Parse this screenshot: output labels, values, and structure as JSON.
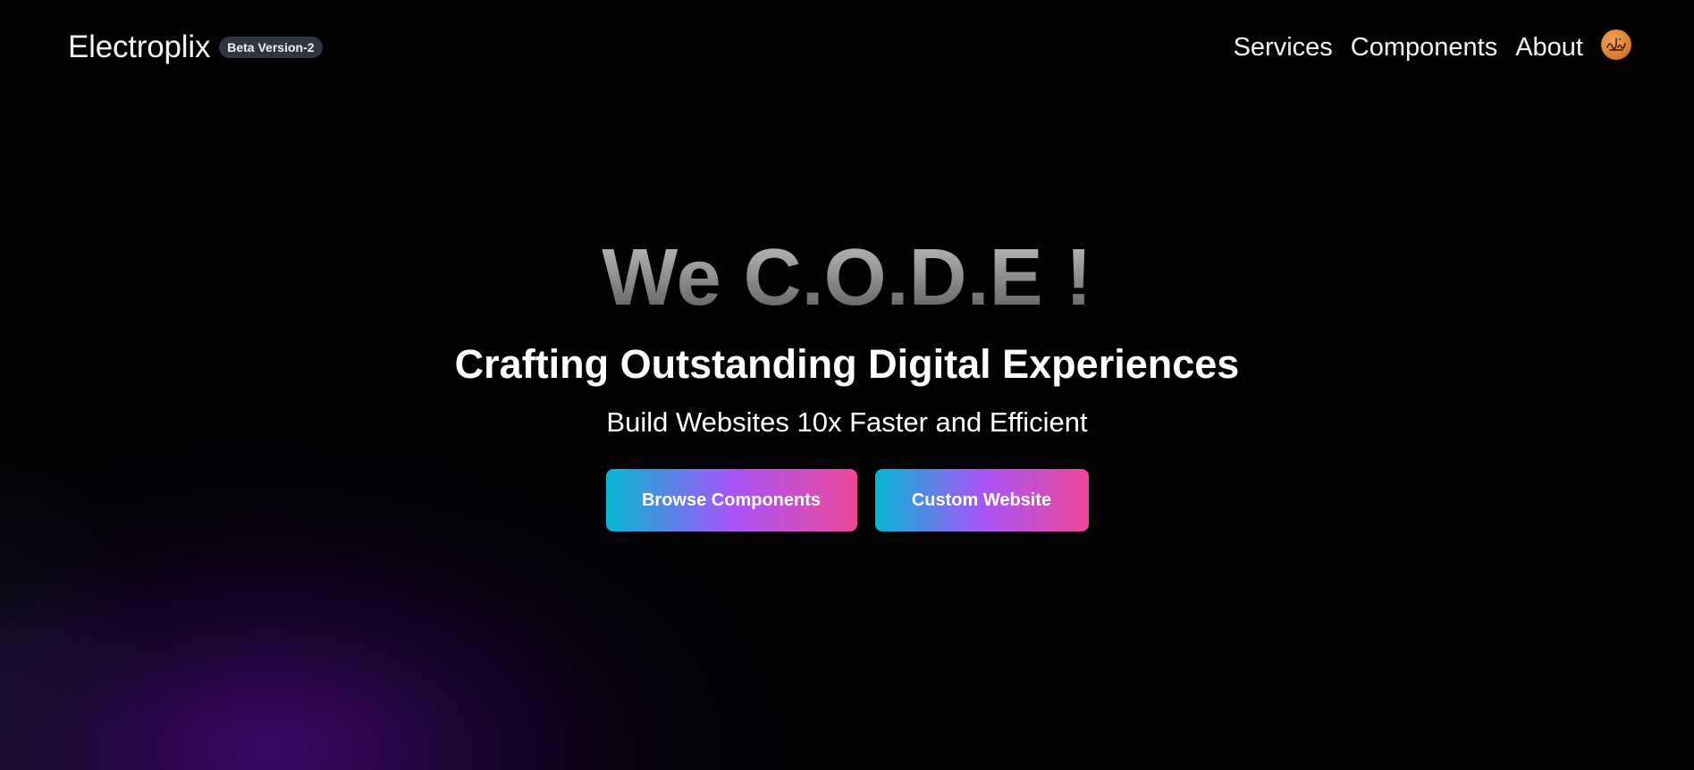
{
  "header": {
    "brand": "Electroplix",
    "badge": "Beta Version-2",
    "nav": [
      {
        "label": "Services"
      },
      {
        "label": "Components"
      },
      {
        "label": "About"
      }
    ],
    "avatar_icon": "avatar-logo-icon"
  },
  "hero": {
    "title": "We C.O.D.E !",
    "subtitle": "Crafting Outstanding Digital Experiences",
    "tagline": "Build Websites 10x Faster and Efficient",
    "buttons": {
      "browse": "Browse Components",
      "custom": "Custom Website"
    }
  },
  "colors": {
    "background": "#000000",
    "badge_bg": "#2f3542",
    "gradient_start": "#06b6d4",
    "gradient_mid": "#a855f7",
    "gradient_end": "#ec4899",
    "glow": "#3b0764"
  }
}
